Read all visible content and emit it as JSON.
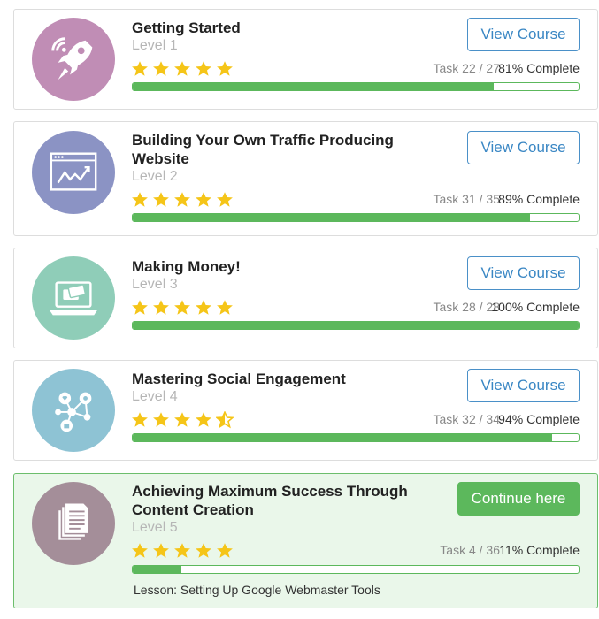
{
  "courses": [
    {
      "title": "Getting Started",
      "level": "Level 1",
      "rating": 5,
      "task": "Task 22 / 27",
      "complete": "81% Complete",
      "progress": 0.81,
      "button": "View Course",
      "avatar_color": "#c08db5",
      "icon": "rocket-icon"
    },
    {
      "title": "Building Your Own Traffic Producing Website",
      "level": "Level 2",
      "rating": 5,
      "task": "Task 31 / 35",
      "complete": "89% Complete",
      "progress": 0.89,
      "button": "View Course",
      "avatar_color": "#8b93c4",
      "icon": "browser-chart-icon"
    },
    {
      "title": "Making Money!",
      "level": "Level 3",
      "rating": 5,
      "task": "Task 28 / 28",
      "complete": "100% Complete",
      "progress": 1.0,
      "button": "View Course",
      "avatar_color": "#8fcdb8",
      "icon": "laptop-card-icon"
    },
    {
      "title": "Mastering Social Engagement",
      "level": "Level 4",
      "rating": 4.5,
      "task": "Task 32 / 34",
      "complete": "94% Complete",
      "progress": 0.94,
      "button": "View Course",
      "avatar_color": "#8ec3d4",
      "icon": "social-network-icon"
    },
    {
      "title": "Achieving Maximum Success Through Content Creation",
      "level": "Level 5",
      "rating": 5,
      "task": "Task 4 / 36",
      "complete": "11% Complete",
      "progress": 0.11,
      "button": "Continue here",
      "avatar_color": "#a48e99",
      "icon": "documents-icon",
      "lesson": "Lesson: Setting Up Google Webmaster Tools"
    }
  ],
  "colors": {
    "star": "#f5c518",
    "progress": "#5cb85c",
    "button_border": "#4a90c8",
    "active_background": "#eaf7ea"
  }
}
